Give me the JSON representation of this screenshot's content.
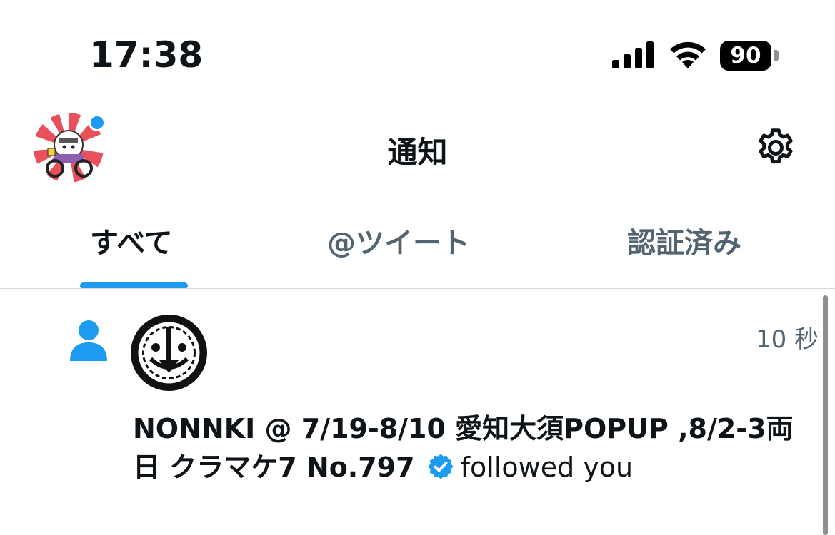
{
  "status_bar": {
    "time": "17:38",
    "battery": "90",
    "icons": [
      "cellular-signal-icon",
      "wifi-icon",
      "battery-icon"
    ]
  },
  "header": {
    "title": "通知",
    "icons": [
      "profile-avatar",
      "settings-gear-icon"
    ]
  },
  "tabs": [
    {
      "label": "すべて",
      "selected": true
    },
    {
      "label": "@ツイート",
      "selected": false
    },
    {
      "label": "認証済み",
      "selected": false
    }
  ],
  "notifications": [
    {
      "type": "follow",
      "icon": "person-icon",
      "timestamp": "10 秒",
      "user_name": "NONNKI @ 7/19-8/10 愛知大須POPUP ,8/2-3両日 クラマケ7 No.797",
      "verified": true,
      "action": "followed you"
    }
  ],
  "colors": {
    "accent": "#1d9bf0",
    "text": "#0f1419",
    "secondary_text": "#536471",
    "divider": "#cfd9de"
  }
}
